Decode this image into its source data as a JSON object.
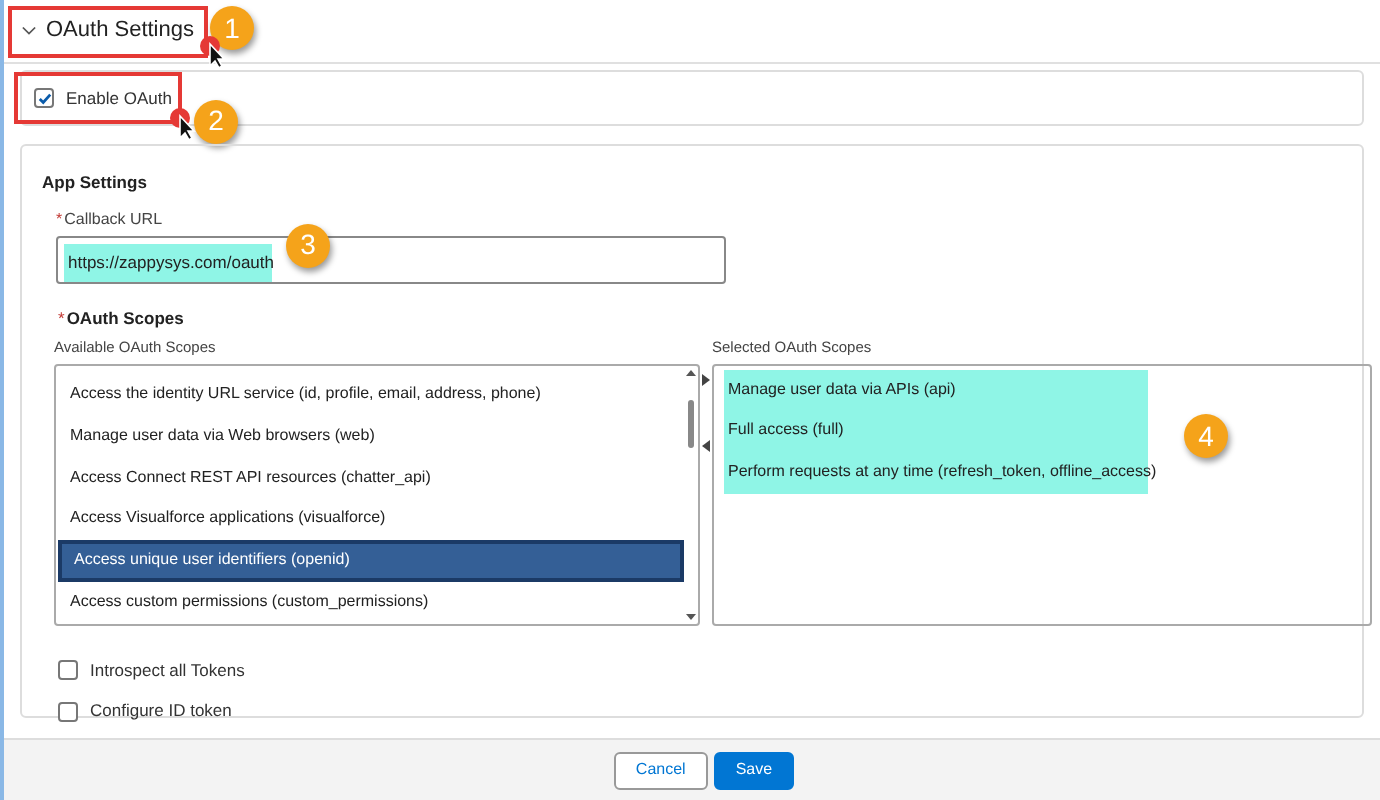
{
  "section": {
    "title": "OAuth Settings",
    "expanded": true
  },
  "enable_oauth": {
    "label": "Enable OAuth",
    "checked": true
  },
  "app_settings": {
    "title": "App Settings",
    "callback_url": {
      "required_mark": "*",
      "label": "Callback URL",
      "value": "https://zappysys.com/oauth",
      "highlighted": true
    },
    "scopes": {
      "required_mark": "*",
      "label": "OAuth Scopes",
      "available": {
        "label": "Available OAuth Scopes",
        "items": [
          {
            "label": "Access the identity URL service (id, profile, email, address, phone)",
            "selected": false
          },
          {
            "label": "Manage user data via Web browsers (web)",
            "selected": false
          },
          {
            "label": "Access Connect REST API resources (chatter_api)",
            "selected": false
          },
          {
            "label": "Access Visualforce applications (visualforce)",
            "selected": false
          },
          {
            "label": "Access unique user identifiers (openid)",
            "selected": true
          },
          {
            "label": "Access custom permissions (custom_permissions)",
            "selected": false
          }
        ]
      },
      "selected": {
        "label": "Selected OAuth Scopes",
        "highlighted": true,
        "items": [
          {
            "label": "Manage user data via APIs (api)"
          },
          {
            "label": "Full access (full)"
          },
          {
            "label": "Perform requests at any time (refresh_token, offline_access)"
          }
        ]
      }
    },
    "options": [
      {
        "label": "Introspect all Tokens",
        "checked": false
      },
      {
        "label": "Configure ID token",
        "checked": false
      }
    ]
  },
  "buttons": [
    {
      "label": "Cancel",
      "kind": "secondary"
    },
    {
      "label": "Save",
      "kind": "primary"
    }
  ],
  "annotations": [
    "1",
    "2",
    "3",
    "4"
  ]
}
